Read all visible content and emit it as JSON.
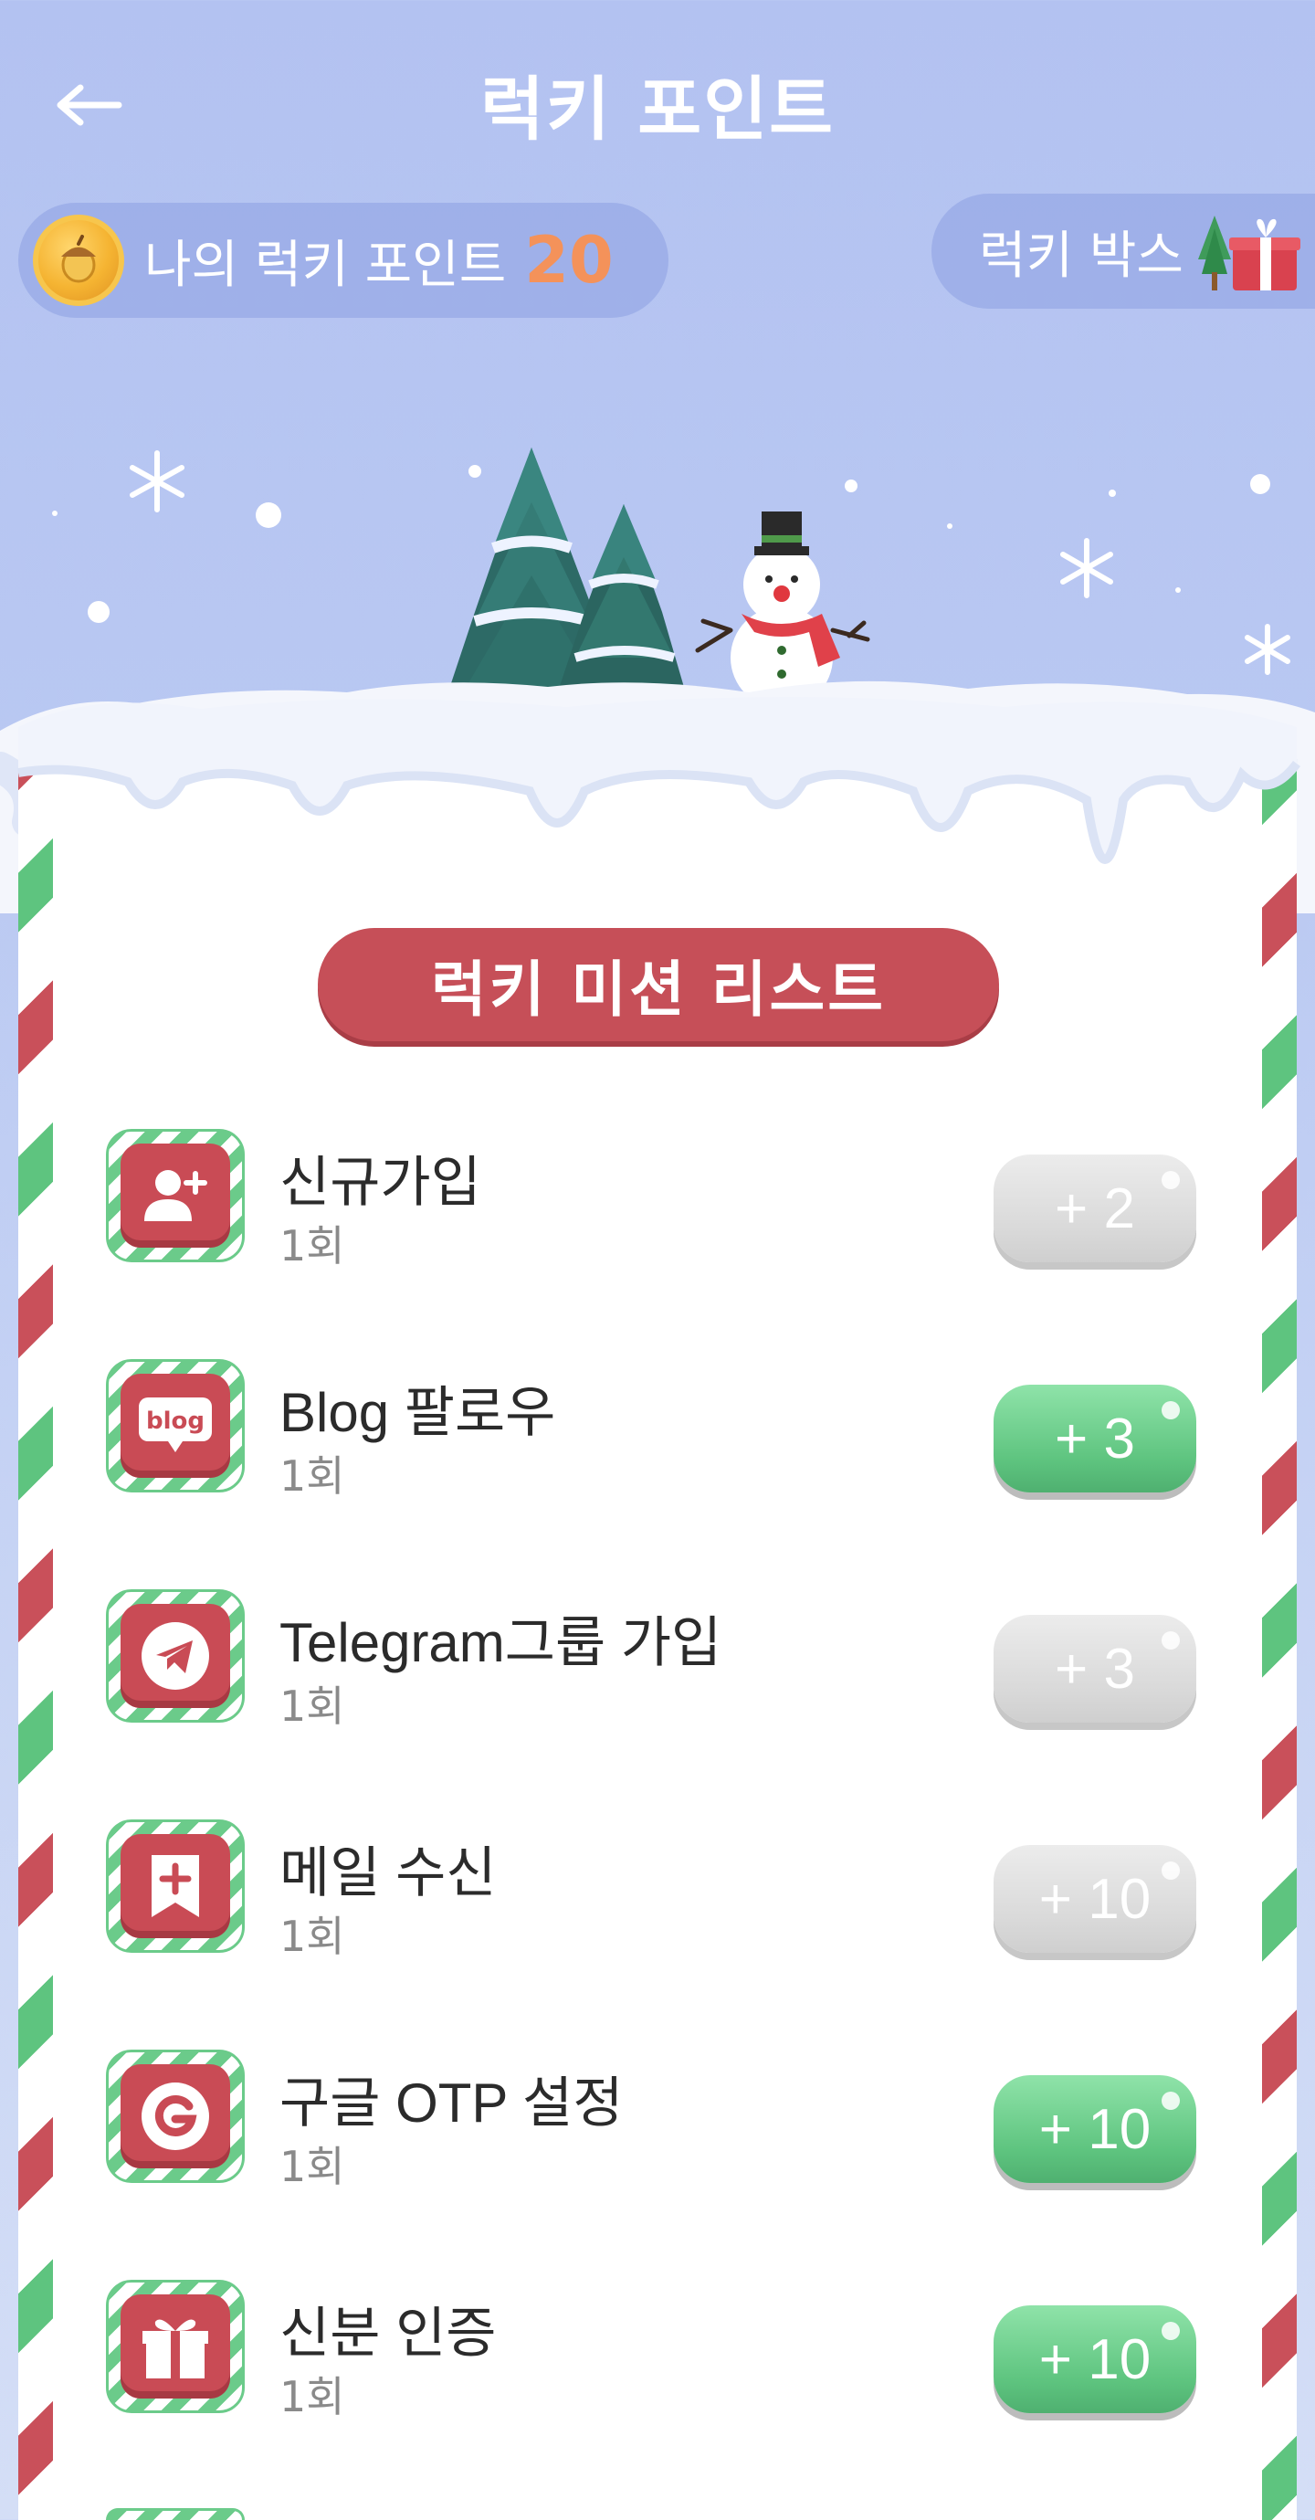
{
  "header": {
    "title": "럭키 포인트",
    "back_icon": "arrow-left-icon"
  },
  "points": {
    "label": "나의 럭키 포인트",
    "value": "20",
    "icon": "acorn-coin-icon"
  },
  "lucky_box": {
    "label": "럭키 박스",
    "icon": "gift-tree-icon"
  },
  "mission_list": {
    "title": "럭키 미션 리스트",
    "items": [
      {
        "name": "신규가입",
        "count": "1회",
        "reward": "+ 2",
        "active": false,
        "icon": "add-user-icon"
      },
      {
        "name": "Blog 팔로우",
        "count": "1회",
        "reward": "+ 3",
        "active": true,
        "icon": "blog-icon"
      },
      {
        "name": "Telegram그룹 가입",
        "count": "1회",
        "reward": "+ 3",
        "active": false,
        "icon": "telegram-icon"
      },
      {
        "name": "메일 수신",
        "count": "1회",
        "reward": "+ 10",
        "active": false,
        "icon": "bookmark-plus-icon"
      },
      {
        "name": "구글 OTP 설정",
        "count": "1회",
        "reward": "+ 10",
        "active": true,
        "icon": "google-icon"
      },
      {
        "name": "신분 인증",
        "count": "1회",
        "reward": "+ 10",
        "active": true,
        "icon": "gift-icon"
      }
    ]
  },
  "colors": {
    "accent_red": "#c64f58",
    "accent_green": "#5ec47f",
    "points_orange": "#f4925a",
    "bg_blue": "#b3c2f1"
  }
}
